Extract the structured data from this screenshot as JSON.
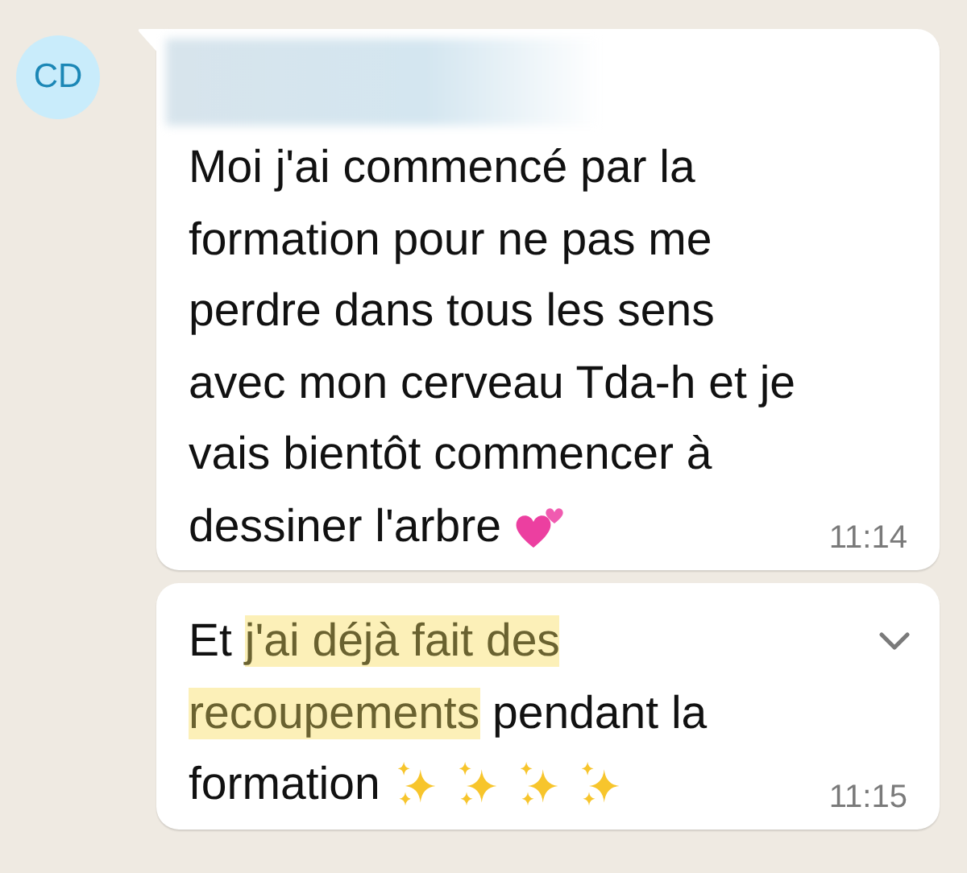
{
  "contact": {
    "initials": "CD"
  },
  "messages": [
    {
      "sender_redacted": true,
      "tail": true,
      "menu": false,
      "lines": [
        [
          {
            "text": "Moi j'ai commencé par la",
            "highlighted": false
          }
        ],
        [
          {
            "text": "formation pour ne pas me",
            "highlighted": false
          }
        ],
        [
          {
            "text": "perdre dans tous les sens",
            "highlighted": false
          }
        ],
        [
          {
            "text": "avec mon cerveau Tda-h et je",
            "highlighted": false
          }
        ],
        [
          {
            "text": "vais bientôt commencer à",
            "highlighted": false
          }
        ],
        [
          {
            "text": "dessiner l'arbre",
            "highlighted": false
          }
        ]
      ],
      "emoji": [
        {
          "kind": "two-hearts"
        }
      ],
      "time": "11:14"
    },
    {
      "sender_redacted": false,
      "tail": false,
      "menu": true,
      "lines": [
        [
          {
            "text": "Et ",
            "highlighted": false
          },
          {
            "text": "j'ai déjà fait des",
            "highlighted": true
          }
        ],
        [
          {
            "text": "recoupements",
            "highlighted": true
          },
          {
            "text": " pendant la",
            "highlighted": false
          }
        ],
        [
          {
            "text": "formation",
            "highlighted": false
          }
        ]
      ],
      "emoji": [
        {
          "kind": "sparkles"
        },
        {
          "kind": "sparkles"
        },
        {
          "kind": "sparkles"
        },
        {
          "kind": "sparkles"
        }
      ],
      "time": "11:15"
    }
  ]
}
